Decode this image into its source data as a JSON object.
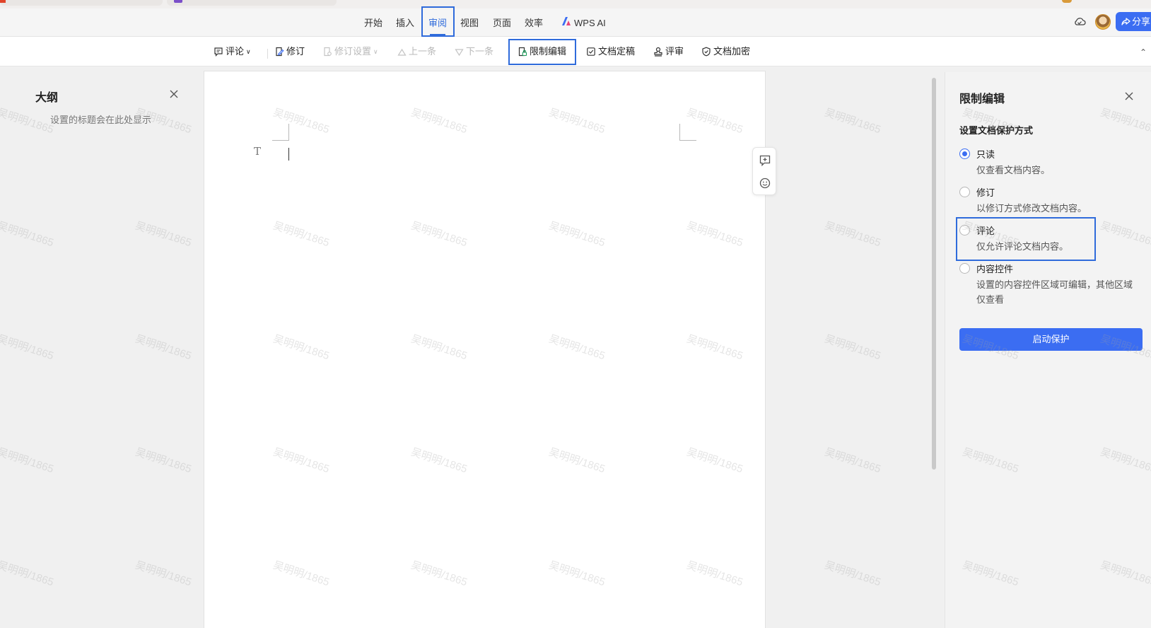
{
  "menu": {
    "items": [
      "开始",
      "插入",
      "审阅",
      "视图",
      "页面",
      "效率"
    ],
    "active_index": 2,
    "wps_ai": "WPS AI",
    "share": "分享"
  },
  "toolbar": {
    "comment": "评论",
    "revise": "修订",
    "revise_settings": "修订设置",
    "prev": "上一条",
    "next": "下一条",
    "restrict_edit": "限制编辑",
    "finalize": "文档定稿",
    "review": "评审",
    "encrypt": "文档加密"
  },
  "outline": {
    "title": "大纲",
    "hint": "设置的标题会在此处显示"
  },
  "document": {
    "style_marker": "T"
  },
  "restrict_panel": {
    "title": "限制编辑",
    "subtitle": "设置文档保护方式",
    "options": [
      {
        "label": "只读",
        "desc": "仅查看文档内容。",
        "checked": true
      },
      {
        "label": "修订",
        "desc": "以修订方式修改文档内容。",
        "checked": false
      },
      {
        "label": "评论",
        "desc": "仅允许评论文档内容。",
        "checked": false
      },
      {
        "label": "内容控件",
        "desc": "设置的内容控件区域可编辑，其他区域仅查看",
        "checked": false
      }
    ],
    "start_button": "启动保护"
  },
  "watermark_text": "吴明明/1865",
  "colors": {
    "accent": "#3b6df2",
    "highlight_box": "#2f6bdb"
  }
}
